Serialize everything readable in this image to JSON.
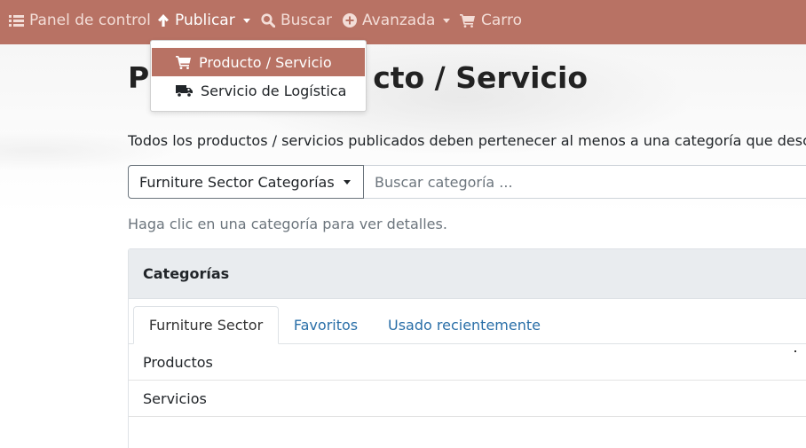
{
  "navbar": {
    "items": [
      {
        "label": "Panel de control",
        "icon": "list-icon"
      },
      {
        "label": "Publicar",
        "icon": "arrow-up-icon"
      },
      {
        "label": "Buscar",
        "icon": "search-icon"
      },
      {
        "label": "Avanzada",
        "icon": "plus-circle-icon"
      },
      {
        "label": "Carro",
        "icon": "cart-icon"
      }
    ],
    "color": "#b87264"
  },
  "publish_menu": {
    "items": [
      {
        "label": "Producto / Servicio",
        "icon": "cart-icon",
        "highlighted": true
      },
      {
        "label": "Servicio de Logística",
        "icon": "truck-icon",
        "highlighted": false
      }
    ]
  },
  "page": {
    "title_left": "P",
    "title_right": "cto / Servicio",
    "intro": "Todos los productos / servicios publicados deben pertenecer al menos a una categoría que desc",
    "sector_button": "Furniture Sector Categorías",
    "search_placeholder": "Buscar categoría ...",
    "hint": "Haga clic en una categoría para ver detalles."
  },
  "card": {
    "header": "Categorías",
    "tabs": [
      {
        "label": "Furniture Sector",
        "active": true
      },
      {
        "label": "Favoritos",
        "active": false
      },
      {
        "label": "Usado recientemente",
        "active": false
      }
    ],
    "rows": [
      {
        "label": "Productos"
      },
      {
        "label": "Servicios"
      }
    ]
  }
}
